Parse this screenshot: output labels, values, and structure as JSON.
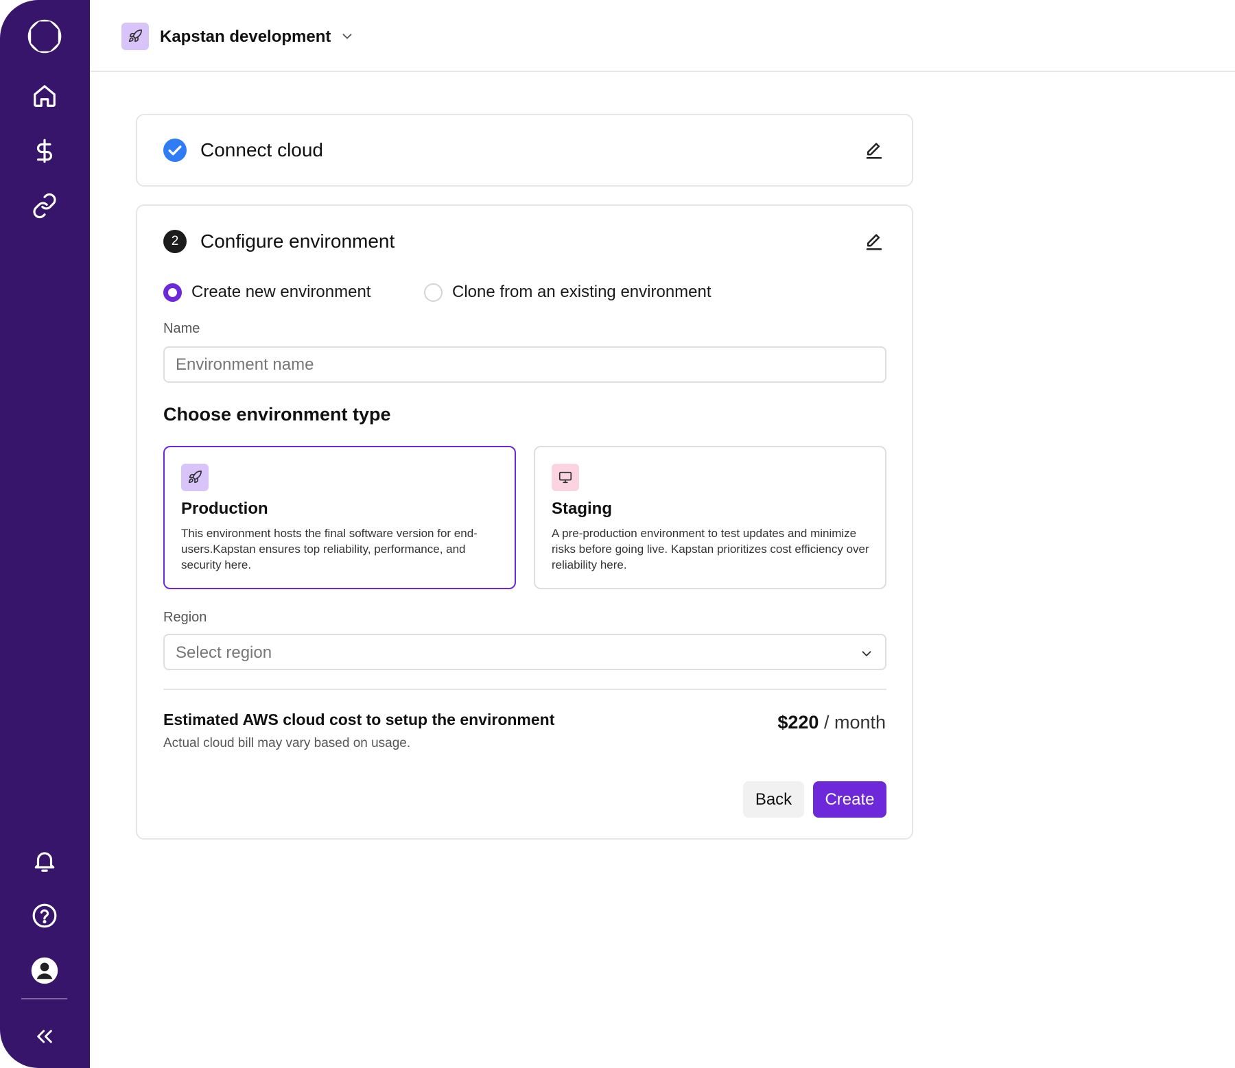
{
  "sidebar": {
    "logo_icon": "octagon-logo-icon",
    "nav": [
      {
        "icon": "home-icon"
      },
      {
        "icon": "dollar-icon"
      },
      {
        "icon": "link-icon"
      }
    ],
    "bottom": [
      {
        "icon": "bell-icon"
      },
      {
        "icon": "help-icon"
      },
      {
        "icon": "user-icon"
      }
    ],
    "collapse_icon": "double-chevron-left-icon",
    "background": "#37156b"
  },
  "header": {
    "workspace_icon": "rocket-icon",
    "workspace_name": "Kapstan development",
    "chevron_icon": "chevron-down-icon"
  },
  "steps": {
    "connect": {
      "title": "Connect cloud",
      "status_icon": "check-circle-icon",
      "edit_icon": "edit-icon"
    },
    "configure": {
      "number": "2",
      "title": "Configure environment",
      "edit_icon": "edit-icon",
      "mode_options": [
        {
          "label": "Create new environment",
          "selected": true
        },
        {
          "label": "Clone from an existing environment",
          "selected": false
        }
      ],
      "name_label": "Name",
      "name_value": "",
      "name_placeholder": "Environment name",
      "type_heading": "Choose environment type",
      "env_types": [
        {
          "icon": "rocket-icon",
          "title": "Production",
          "description": "This environment hosts the final software version for end-users.Kapstan ensures top reliability, performance, and security here.",
          "selected": true
        },
        {
          "icon": "monitor-icon",
          "title": "Staging",
          "description": "A pre-production environment to test updates and minimize risks before going live. Kapstan prioritizes cost efficiency over reliability here.",
          "selected": false
        }
      ],
      "region_label": "Region",
      "region_placeholder": "Select region",
      "cost_title": "Estimated AWS cloud cost to setup the environment",
      "cost_note": "Actual cloud bill may vary based on usage.",
      "cost_amount": "$220",
      "cost_period": " / month",
      "back_label": "Back",
      "create_label": "Create"
    }
  },
  "colors": {
    "accent": "#6d28d9",
    "check": "#2f7cf6",
    "production_icon_bg": "#d9c4fa",
    "staging_icon_bg": "#fcd3e1"
  }
}
